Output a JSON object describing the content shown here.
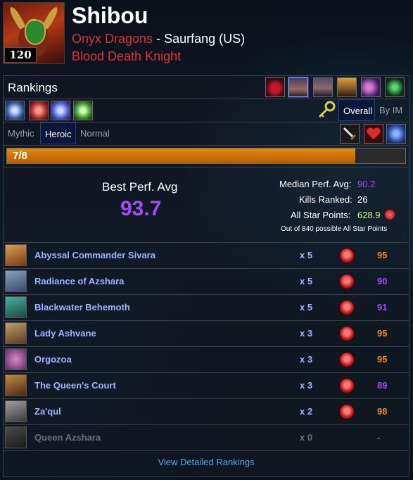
{
  "character": {
    "name": "Shibou",
    "level": "120",
    "guild": "Onyx Dragons",
    "separator": " - ",
    "realm": "Saurfang (US)",
    "spec": "Blood Death Knight"
  },
  "rankings": {
    "title": "Rankings",
    "zone_icons": [
      "eternal-palace-icon",
      "battle-of-dazaralor-icon",
      "crucible-of-storms-icon",
      "uldir-icon",
      "nyalotha-icon",
      "sepulcher-icon"
    ],
    "metric_icons": [
      "dps-icon",
      "hps-icon",
      "tank-icon",
      "boss-dps-icon"
    ],
    "view_toggle": {
      "key_icon": "key-icon",
      "overall_label": "Overall",
      "byilvl_label": "By IM"
    },
    "difficulty_tabs": [
      "Mythic",
      "Heroic",
      "Normal"
    ],
    "role_icons": [
      "sword-icon",
      "heart-icon",
      "shield-icon"
    ]
  },
  "progress": {
    "label": "7/8",
    "fraction": 0.875
  },
  "summary": {
    "best_perf_label": "Best Perf. Avg",
    "best_perf_value": "93.7",
    "median_label": "Median Perf. Avg:",
    "median_value": "90.2",
    "kills_label": "Kills Ranked:",
    "kills_value": "26",
    "star_label": "All Star Points:",
    "star_value": "628.9",
    "star_note": "Out of 840 possible All Star Points"
  },
  "bosses": [
    {
      "name": "Abyssal Commander Sivara",
      "kills": "x 5",
      "score": "95",
      "color": "#f08a24"
    },
    {
      "name": "Radiance of Azshara",
      "kills": "x 5",
      "score": "90",
      "color": "#a44cf0"
    },
    {
      "name": "Blackwater Behemoth",
      "kills": "x 5",
      "score": "91",
      "color": "#a44cf0"
    },
    {
      "name": "Lady Ashvane",
      "kills": "x 3",
      "score": "95",
      "color": "#f08a24"
    },
    {
      "name": "Orgozoa",
      "kills": "x 3",
      "score": "95",
      "color": "#f08a24"
    },
    {
      "name": "The Queen's Court",
      "kills": "x 3",
      "score": "89",
      "color": "#a44cf0"
    },
    {
      "name": "Za'qul",
      "kills": "x 2",
      "score": "98",
      "color": "#f08a24"
    },
    {
      "name": "Queen Azshara",
      "kills": "x 0",
      "score": "-",
      "color": "#6b6f74",
      "dim": true
    }
  ],
  "footer": {
    "link_label": "View Detailed Rankings"
  },
  "colors": {
    "guild": "#e0323c",
    "epic": "#a44cf0",
    "legendary": "#f08a24",
    "link": "#5fa6e8"
  }
}
